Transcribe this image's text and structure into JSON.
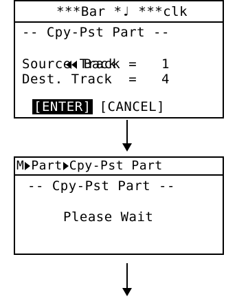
{
  "screen1": {
    "status": "***Bar *♩ ***clk",
    "title": "-- Cpy-Pst Part --",
    "back_label": "Back",
    "source_track": {
      "label": "Source Track",
      "eq": "=",
      "value": "1"
    },
    "dest_track": {
      "label": "Dest. Track",
      "eq": "=",
      "value": "4"
    },
    "enter_label": "[ENTER]",
    "cancel_label": "[CANCEL]"
  },
  "screen2": {
    "crumb_m": "M",
    "crumb_part": "Part",
    "crumb_page": "Cpy-Pst Part",
    "title": "-- Cpy-Pst Part --",
    "message": "Please Wait"
  }
}
